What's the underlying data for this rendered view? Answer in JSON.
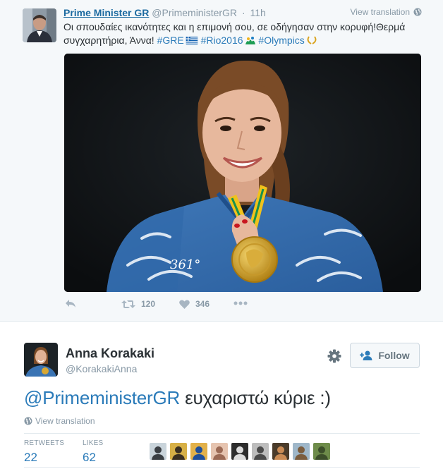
{
  "parent_tweet": {
    "name": "Prime Minister GR",
    "handle": "@PrimeministerGR",
    "separator": "·",
    "time": "11h",
    "view_translation": "View translation",
    "text_main": "Οι σπουδαίες ικανότητες και η επιμονή σου, σε οδήγησαν στην κορυφή!Θερμά συγχαρητήρια, Άννα! ",
    "hashtags": [
      "#GRE",
      "#Rio2016",
      "#Olympics"
    ],
    "retweet_count": "120",
    "like_count": "346",
    "media": {
      "jacket_text": "361°"
    },
    "icons": [
      "reply-icon",
      "retweet-icon",
      "heart-icon",
      "more-icon",
      "globe-icon"
    ]
  },
  "main_tweet": {
    "name": "Anna Korakaki",
    "handle": "@KorakakiAnna",
    "follow_label": "Follow",
    "mention": "@PrimeministerGR",
    "text_rest": " ευχαριστώ κύριε :)",
    "view_translation": "View translation",
    "stats": [
      {
        "label": "RETWEETS",
        "value": "22"
      },
      {
        "label": "LIKES",
        "value": "62"
      }
    ],
    "likers": [
      {
        "bg": "#c9d4db",
        "fg": "#3a3f44"
      },
      {
        "bg": "#d7b046",
        "fg": "#3b3020"
      },
      {
        "bg": "#e2b14a",
        "fg": "#1f4f9a"
      },
      {
        "bg": "#e6c4b0",
        "fg": "#9c6a55"
      },
      {
        "bg": "#2d2d2d",
        "fg": "#dcdcdc"
      },
      {
        "bg": "#bdbdbd",
        "fg": "#4b4b4b"
      },
      {
        "bg": "#4a3b2a",
        "fg": "#c98b55"
      },
      {
        "bg": "#9fb7c9",
        "fg": "#7b5d3f"
      },
      {
        "bg": "#6e8c4a",
        "fg": "#3c4f2a"
      }
    ],
    "icons": [
      "gear-icon",
      "add-user-icon",
      "globe-icon"
    ]
  },
  "colors": {
    "link": "#2b7bb9",
    "muted": "#8899a6",
    "text": "#292f33",
    "parent_bg": "#f5f8fa"
  }
}
